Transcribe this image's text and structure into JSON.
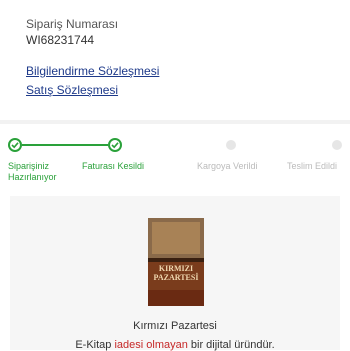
{
  "order": {
    "number_label": "Sipariş Numarası",
    "number_value": "WI68231744"
  },
  "links": {
    "info_agreement": "Bilgilendirme Sözleşmesi",
    "sales_agreement": "Satış Sözleşmesi"
  },
  "tracker": {
    "steps": [
      {
        "label_line1": "Siparişiniz",
        "label_line2": "Hazırlanıyor",
        "status": "done"
      },
      {
        "label_line1": "Faturası Kesildi",
        "label_line2": "",
        "status": "done"
      },
      {
        "label_line1": "Kargoya Verildi",
        "label_line2": "",
        "status": "pending"
      },
      {
        "label_line1": "Teslim Edildi",
        "label_line2": "",
        "status": "pending"
      }
    ]
  },
  "product": {
    "cover_title": "KIRMIZI PAZARTESİ",
    "title": "Kırmızı Pazartesi",
    "note_prefix": "E-Kitap ",
    "note_highlight": "iadesi olmayan",
    "note_suffix": " bir dijital üründür."
  },
  "colors": {
    "success": "#2aa13a",
    "link": "#1e3a8a",
    "warning": "#c62828",
    "pending": "#e6e6e6"
  }
}
